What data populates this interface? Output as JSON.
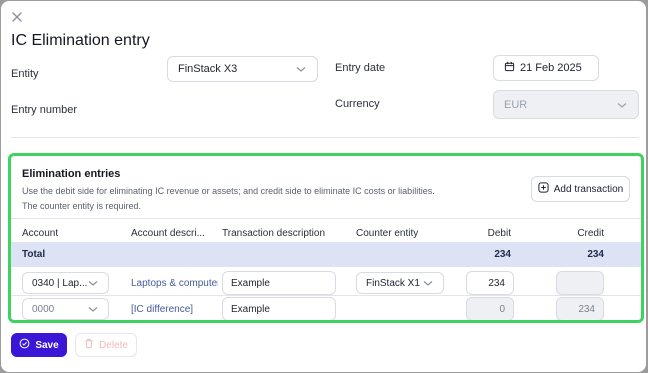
{
  "modal": {
    "title": "IC Elimination entry",
    "close_icon": "close-icon"
  },
  "form": {
    "entity_label": "Entity",
    "entity_value": "FinStack X3",
    "entry_date_label": "Entry date",
    "entry_date_value": "21 Feb 2025",
    "entry_number_label": "Entry number",
    "currency_label": "Currency",
    "currency_value": "EUR"
  },
  "elimination": {
    "title": "Elimination entries",
    "desc_line1": "Use the debit side for eliminating IC revenue or assets; and credit side to eliminate IC costs or liabilities.",
    "desc_line2": "The counter entity is required.",
    "add_label": "Add transaction",
    "columns": {
      "account": "Account",
      "account_desc": "Account descri...",
      "transaction_desc": "Transaction description",
      "counter_entity": "Counter entity",
      "debit": "Debit",
      "credit": "Credit"
    },
    "total": {
      "label": "Total",
      "debit": "234",
      "credit": "234"
    },
    "rows": [
      {
        "account": "0340 | Lap...",
        "account_desc": "Laptops & computers",
        "transaction_desc": "Example",
        "counter_entity": "FinStack X1",
        "debit": "234",
        "credit": ""
      },
      {
        "account": "0000",
        "account_desc": "[IC difference]",
        "transaction_desc": "Example",
        "counter_entity": "",
        "debit": "0",
        "credit": "234"
      }
    ]
  },
  "actions": {
    "save_label": "Save",
    "delete_label": "Delete"
  },
  "colors": {
    "accent": "#3b16d6",
    "highlight_border": "#3ed25f",
    "total_bg": "#dde3f5"
  }
}
